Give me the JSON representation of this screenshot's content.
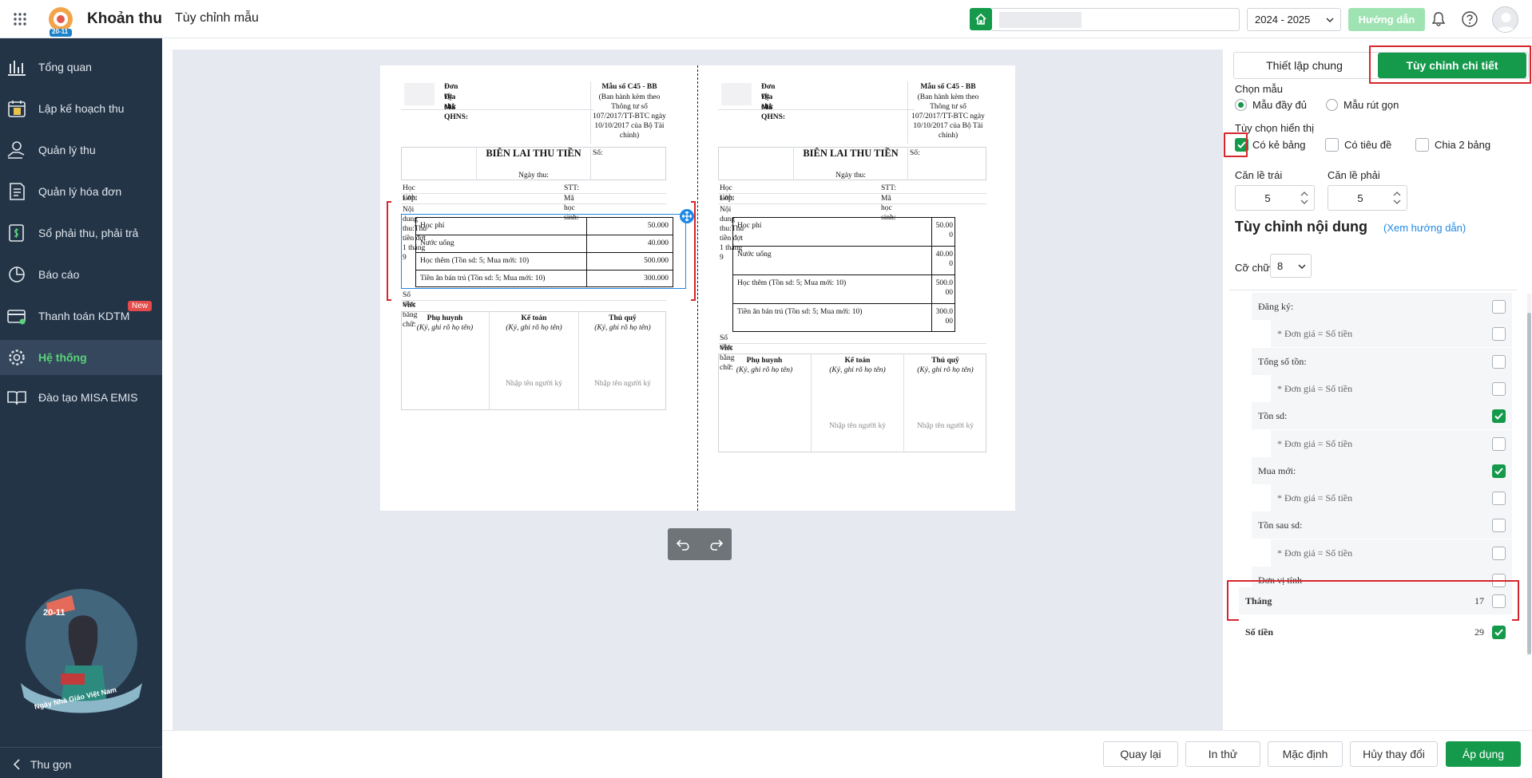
{
  "app": {
    "title": "Khoản thu",
    "page": "Tùy chỉnh mẫu",
    "year": "2024 - 2025",
    "guide": "Hướng dẫn",
    "badge": "20-11"
  },
  "sidebar": {
    "items": [
      {
        "label": "Tổng quan",
        "icon": "chart-icon"
      },
      {
        "label": "Lập kế hoạch thu",
        "icon": "calendar-money-icon"
      },
      {
        "label": "Quản lý thu",
        "icon": "hand-coin-icon"
      },
      {
        "label": "Quản lý hóa đơn",
        "icon": "invoice-icon"
      },
      {
        "label": "Sổ phải thu, phải trả",
        "icon": "ledger-icon"
      },
      {
        "label": "Báo cáo",
        "icon": "pie-chart-icon"
      },
      {
        "label": "Thanh toán KDTM",
        "icon": "card-icon",
        "badge": "New"
      },
      {
        "label": "Hệ thống",
        "icon": "gear-icon",
        "active": true
      },
      {
        "label": "Đào tạo MISA EMIS",
        "icon": "book-icon"
      }
    ],
    "banner": "Ngày Nhà Giáo Việt Nam",
    "banner_badge": "20-11",
    "collapse": "Thu gọn"
  },
  "receipt": {
    "don_vi": "Đơn vị:",
    "dia_chi": "Địa chỉ:",
    "ma_qhns": "Mã QHNS:",
    "mau_so": "Mẫu số C45 - BB",
    "ban_hanh": "(Ban hành kèm theo Thông tư số 107/2017/TT-BTC ngày 10/10/2017 của Bộ Tài chính)",
    "title": "BIÊN LAI THU TIỀN",
    "ngay_thu": "Ngày thu:",
    "so": "Số:",
    "hoc_sinh": "Học sinh:",
    "stt": "STT:",
    "lop": "Lớp:",
    "ma_hoc_sinh": "Mã học sinh:",
    "noi_dung": "Nội dung thu:Thu tiền đợt 1 tháng 9",
    "items": [
      {
        "name": "Học phí",
        "amount": "50.000",
        "amount_wrapped": [
          "50.00",
          "0"
        ]
      },
      {
        "name": "Nước uống",
        "amount": "40.000",
        "amount_wrapped": [
          "40.00",
          "0"
        ]
      },
      {
        "name": "Học thêm (Tồn sd: 5; Mua mới: 10)",
        "amount": "500.000",
        "amount_wrapped": [
          "500.0",
          "00"
        ]
      },
      {
        "name": "Tiền ăn bán trú (Tồn sd: 5; Mua mới: 10)",
        "amount": "300.000",
        "amount_wrapped": [
          "300.0",
          "00"
        ]
      }
    ],
    "so_tien": "Số tiền:",
    "viet_bang_chu": "Viết bằng chữ:",
    "sign": [
      {
        "role": "Phụ huynh",
        "note": "(Ký, ghi rõ họ tên)",
        "placeholder": ""
      },
      {
        "role": "Kế toán",
        "note": "(Ký, ghi rõ họ tên)",
        "placeholder": "Nhập tên người ký"
      },
      {
        "role": "Thủ quỹ",
        "note": "(Ký, ghi rõ họ tên)",
        "placeholder": "Nhập tên người ký"
      }
    ]
  },
  "panel": {
    "tab_general": "Thiết lập chung",
    "tab_detail": "Tùy chỉnh chi tiết",
    "chon_mau": "Chọn mẫu",
    "mau_day_du": "Mẫu đầy đủ",
    "mau_rut_gon": "Mẫu rút gọn",
    "tuy_chon": "Tùy chọn hiển thị",
    "co_ke_bang": "Có kẻ bảng",
    "co_tieu_de": "Có tiêu đề",
    "chia_2_bang": "Chia 2 bảng",
    "can_le_trai": "Căn lề trái",
    "can_le_phai": "Căn lề phải",
    "le_trai_val": "5",
    "le_phai_val": "5",
    "tuy_chinh_noi_dung": "Tùy chỉnh nội dung",
    "xem_huong_dan": "(Xem hướng dẫn)",
    "co_chu": "Cỡ chữ",
    "co_chu_val": "8",
    "rows": [
      {
        "label": "Đăng ký:",
        "checked": false,
        "sub": false
      },
      {
        "label": "* Đơn giá = Số tiền",
        "checked": false,
        "sub": true
      },
      {
        "label": "Tổng số tồn:",
        "checked": false,
        "sub": false
      },
      {
        "label": "* Đơn giá = Số tiền",
        "checked": false,
        "sub": true
      },
      {
        "label": "Tồn sd:",
        "checked": true,
        "sub": false
      },
      {
        "label": "* Đơn giá = Số tiền",
        "checked": false,
        "sub": true
      },
      {
        "label": "Mua mới:",
        "checked": true,
        "sub": false
      },
      {
        "label": "* Đơn giá = Số tiền",
        "checked": false,
        "sub": true
      },
      {
        "label": "Tồn sau sd:",
        "checked": false,
        "sub": false
      },
      {
        "label": "* Đơn giá = Số tiền",
        "checked": false,
        "sub": true
      },
      {
        "label": "Đơn vị tính",
        "checked": false,
        "sub": false
      }
    ],
    "thang": "Tháng",
    "thang_num": "17",
    "so_tien": "Số tiền",
    "so_tien_num": "29"
  },
  "footer": {
    "back": "Quay lại",
    "print": "In thử",
    "default": "Mặc định",
    "cancel": "Hủy thay đổi",
    "apply": "Áp dụng"
  },
  "colors": {
    "primary": "#159a4c",
    "sidebar": "#243447",
    "highlight": "#d6262b"
  }
}
